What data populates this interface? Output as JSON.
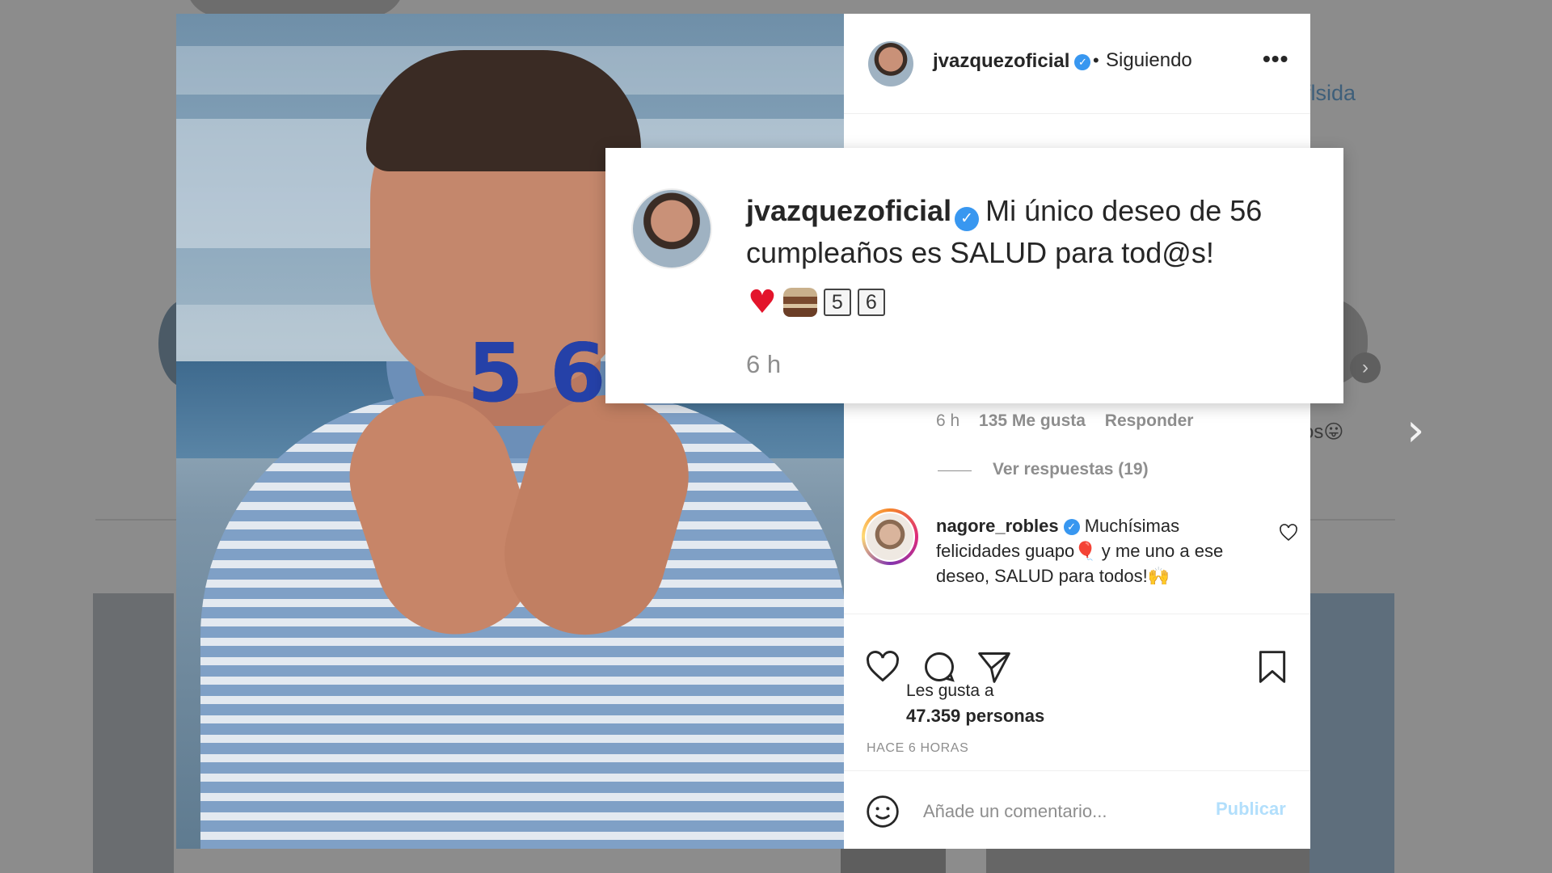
{
  "background": {
    "username_tail": "flsida",
    "caption_tail": "os"
  },
  "post": {
    "author": {
      "username": "jvazquezoficial",
      "follow_status": "Siguiendo",
      "separator": "•"
    },
    "photo": {
      "candle_digit_1": "5",
      "candle_digit_2": "6"
    },
    "caption": {
      "username": "jvazquezoficial",
      "text": "Mi único deseo de 56 cumpleaños es SALUD para tod@s!",
      "emoji_keycaps": [
        "5",
        "6"
      ],
      "time": "6 h"
    },
    "first_comment_meta": {
      "time": "6 h",
      "likes": "135 Me gusta",
      "reply_label": "Responder",
      "view_replies": "Ver respuestas (19)"
    },
    "comment": {
      "username": "nagore_robles",
      "text_part1": "Muchísimas felicidades guapo",
      "text_part2": " y me uno a ese deseo, SALUD para todos!"
    },
    "likes_label": "Les gusta a",
    "likes_count": "47.359 personas",
    "time_ago": "HACE 6 HORAS",
    "comment_box": {
      "placeholder": "Añade un comentario...",
      "publish_label": "Publicar"
    }
  },
  "icons": {
    "verified": "verified-badge-icon",
    "more": "more-options-icon",
    "like": "heart-icon",
    "comment": "comment-bubble-icon",
    "share": "paper-plane-icon",
    "save": "bookmark-icon",
    "emoji": "smiley-icon",
    "next": "chevron-right-icon"
  },
  "colors": {
    "link_blue": "#3897f0",
    "publish_disabled": "#b2dffc",
    "muted_text": "#8e8e8e"
  }
}
